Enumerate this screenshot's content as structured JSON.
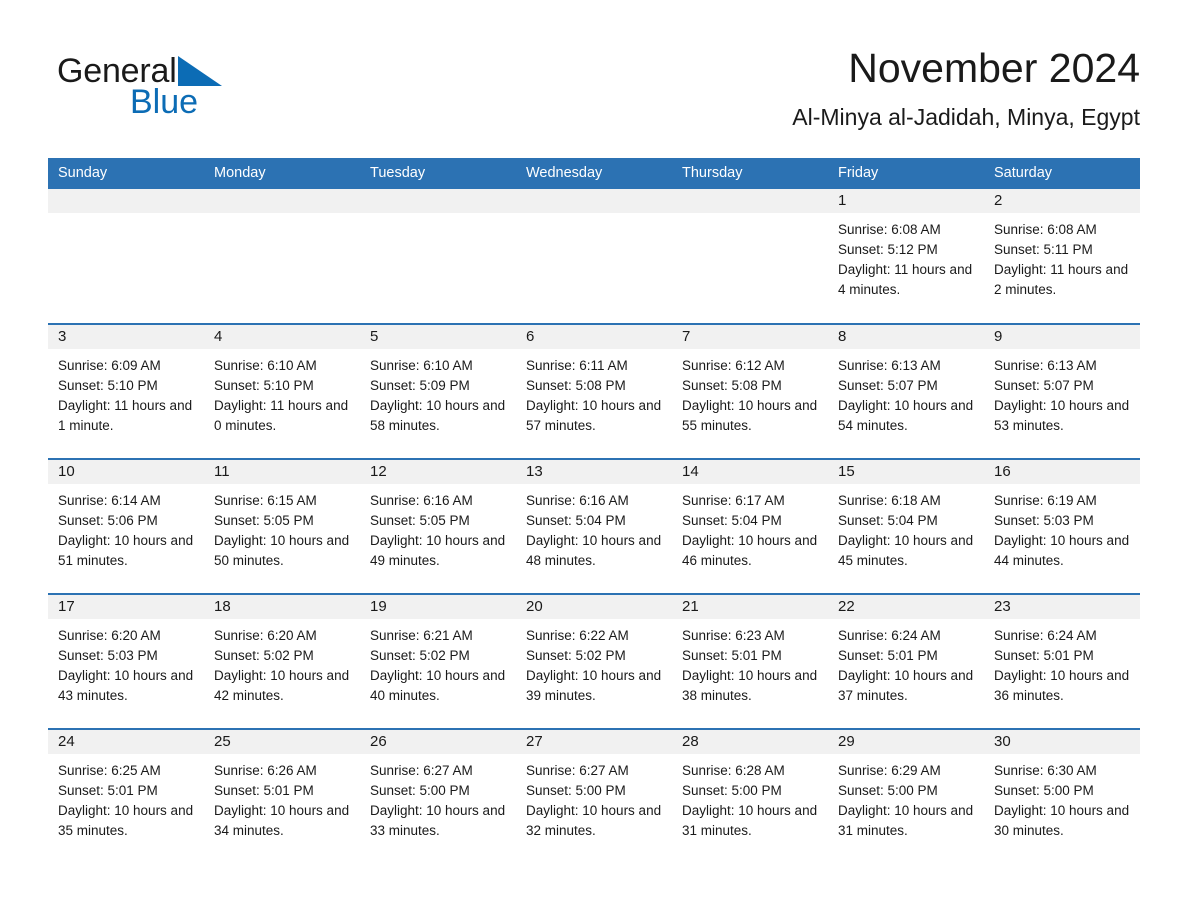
{
  "brand": {
    "name_part1": "General",
    "name_part2": "Blue",
    "color_dark": "#1a1a1a",
    "color_blue": "#0c6cb5"
  },
  "header": {
    "title": "November 2024",
    "subtitle": "Al-Minya al-Jadidah, Minya, Egypt"
  },
  "theme": {
    "header_bar": "#2c72b3",
    "row_divider": "#2c72b3",
    "daynum_band": "#f1f1f1",
    "text": "#1a1a1a"
  },
  "weekday_headers": [
    "Sunday",
    "Monday",
    "Tuesday",
    "Wednesday",
    "Thursday",
    "Friday",
    "Saturday"
  ],
  "labels": {
    "sunrise_prefix": "Sunrise:",
    "sunset_prefix": "Sunset:",
    "daylight_prefix": "Daylight:"
  },
  "weeks": [
    [
      {
        "day": "",
        "blank": true
      },
      {
        "day": "",
        "blank": true
      },
      {
        "day": "",
        "blank": true
      },
      {
        "day": "",
        "blank": true
      },
      {
        "day": "",
        "blank": true
      },
      {
        "day": "1",
        "sunrise": "Sunrise: 6:08 AM",
        "sunset": "Sunset: 5:12 PM",
        "daylight": "Daylight: 11 hours and 4 minutes."
      },
      {
        "day": "2",
        "sunrise": "Sunrise: 6:08 AM",
        "sunset": "Sunset: 5:11 PM",
        "daylight": "Daylight: 11 hours and 2 minutes."
      }
    ],
    [
      {
        "day": "3",
        "sunrise": "Sunrise: 6:09 AM",
        "sunset": "Sunset: 5:10 PM",
        "daylight": "Daylight: 11 hours and 1 minute."
      },
      {
        "day": "4",
        "sunrise": "Sunrise: 6:10 AM",
        "sunset": "Sunset: 5:10 PM",
        "daylight": "Daylight: 11 hours and 0 minutes."
      },
      {
        "day": "5",
        "sunrise": "Sunrise: 6:10 AM",
        "sunset": "Sunset: 5:09 PM",
        "daylight": "Daylight: 10 hours and 58 minutes."
      },
      {
        "day": "6",
        "sunrise": "Sunrise: 6:11 AM",
        "sunset": "Sunset: 5:08 PM",
        "daylight": "Daylight: 10 hours and 57 minutes."
      },
      {
        "day": "7",
        "sunrise": "Sunrise: 6:12 AM",
        "sunset": "Sunset: 5:08 PM",
        "daylight": "Daylight: 10 hours and 55 minutes."
      },
      {
        "day": "8",
        "sunrise": "Sunrise: 6:13 AM",
        "sunset": "Sunset: 5:07 PM",
        "daylight": "Daylight: 10 hours and 54 minutes."
      },
      {
        "day": "9",
        "sunrise": "Sunrise: 6:13 AM",
        "sunset": "Sunset: 5:07 PM",
        "daylight": "Daylight: 10 hours and 53 minutes."
      }
    ],
    [
      {
        "day": "10",
        "sunrise": "Sunrise: 6:14 AM",
        "sunset": "Sunset: 5:06 PM",
        "daylight": "Daylight: 10 hours and 51 minutes."
      },
      {
        "day": "11",
        "sunrise": "Sunrise: 6:15 AM",
        "sunset": "Sunset: 5:05 PM",
        "daylight": "Daylight: 10 hours and 50 minutes."
      },
      {
        "day": "12",
        "sunrise": "Sunrise: 6:16 AM",
        "sunset": "Sunset: 5:05 PM",
        "daylight": "Daylight: 10 hours and 49 minutes."
      },
      {
        "day": "13",
        "sunrise": "Sunrise: 6:16 AM",
        "sunset": "Sunset: 5:04 PM",
        "daylight": "Daylight: 10 hours and 48 minutes."
      },
      {
        "day": "14",
        "sunrise": "Sunrise: 6:17 AM",
        "sunset": "Sunset: 5:04 PM",
        "daylight": "Daylight: 10 hours and 46 minutes."
      },
      {
        "day": "15",
        "sunrise": "Sunrise: 6:18 AM",
        "sunset": "Sunset: 5:04 PM",
        "daylight": "Daylight: 10 hours and 45 minutes."
      },
      {
        "day": "16",
        "sunrise": "Sunrise: 6:19 AM",
        "sunset": "Sunset: 5:03 PM",
        "daylight": "Daylight: 10 hours and 44 minutes."
      }
    ],
    [
      {
        "day": "17",
        "sunrise": "Sunrise: 6:20 AM",
        "sunset": "Sunset: 5:03 PM",
        "daylight": "Daylight: 10 hours and 43 minutes."
      },
      {
        "day": "18",
        "sunrise": "Sunrise: 6:20 AM",
        "sunset": "Sunset: 5:02 PM",
        "daylight": "Daylight: 10 hours and 42 minutes."
      },
      {
        "day": "19",
        "sunrise": "Sunrise: 6:21 AM",
        "sunset": "Sunset: 5:02 PM",
        "daylight": "Daylight: 10 hours and 40 minutes."
      },
      {
        "day": "20",
        "sunrise": "Sunrise: 6:22 AM",
        "sunset": "Sunset: 5:02 PM",
        "daylight": "Daylight: 10 hours and 39 minutes."
      },
      {
        "day": "21",
        "sunrise": "Sunrise: 6:23 AM",
        "sunset": "Sunset: 5:01 PM",
        "daylight": "Daylight: 10 hours and 38 minutes."
      },
      {
        "day": "22",
        "sunrise": "Sunrise: 6:24 AM",
        "sunset": "Sunset: 5:01 PM",
        "daylight": "Daylight: 10 hours and 37 minutes."
      },
      {
        "day": "23",
        "sunrise": "Sunrise: 6:24 AM",
        "sunset": "Sunset: 5:01 PM",
        "daylight": "Daylight: 10 hours and 36 minutes."
      }
    ],
    [
      {
        "day": "24",
        "sunrise": "Sunrise: 6:25 AM",
        "sunset": "Sunset: 5:01 PM",
        "daylight": "Daylight: 10 hours and 35 minutes."
      },
      {
        "day": "25",
        "sunrise": "Sunrise: 6:26 AM",
        "sunset": "Sunset: 5:01 PM",
        "daylight": "Daylight: 10 hours and 34 minutes."
      },
      {
        "day": "26",
        "sunrise": "Sunrise: 6:27 AM",
        "sunset": "Sunset: 5:00 PM",
        "daylight": "Daylight: 10 hours and 33 minutes."
      },
      {
        "day": "27",
        "sunrise": "Sunrise: 6:27 AM",
        "sunset": "Sunset: 5:00 PM",
        "daylight": "Daylight: 10 hours and 32 minutes."
      },
      {
        "day": "28",
        "sunrise": "Sunrise: 6:28 AM",
        "sunset": "Sunset: 5:00 PM",
        "daylight": "Daylight: 10 hours and 31 minutes."
      },
      {
        "day": "29",
        "sunrise": "Sunrise: 6:29 AM",
        "sunset": "Sunset: 5:00 PM",
        "daylight": "Daylight: 10 hours and 31 minutes."
      },
      {
        "day": "30",
        "sunrise": "Sunrise: 6:30 AM",
        "sunset": "Sunset: 5:00 PM",
        "daylight": "Daylight: 10 hours and 30 minutes."
      }
    ]
  ]
}
